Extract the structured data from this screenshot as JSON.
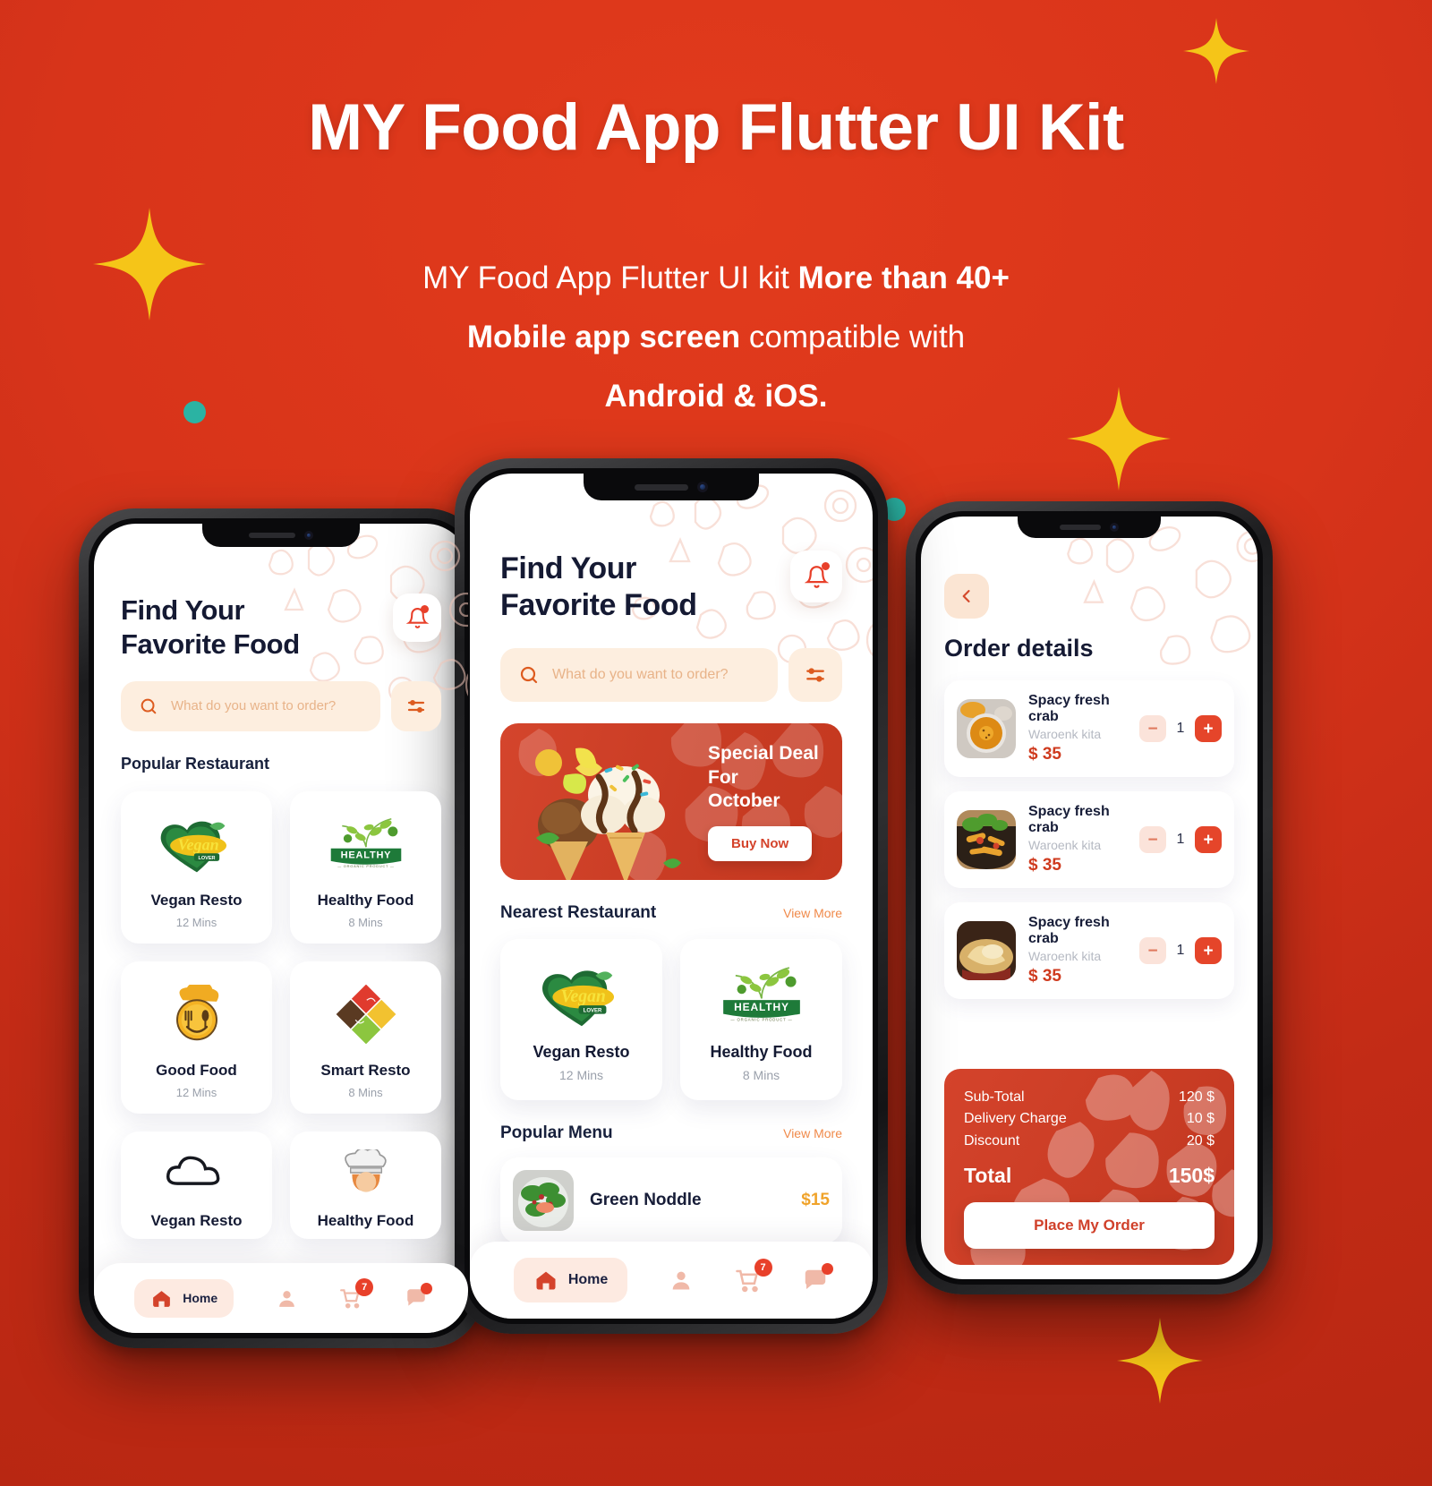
{
  "hero": {
    "title": "MY Food App Flutter UI Kit",
    "subtitle_lines": [
      {
        "normal_1": "MY Food App Flutter UI kit ",
        "bold": "More than 40+",
        "normal_2": ""
      },
      {
        "normal_1": "",
        "bold": "Mobile app screen",
        "normal_2": " compatible with"
      },
      {
        "normal_1": "",
        "bold": "Android & iOS.",
        "normal_2": ""
      }
    ],
    "background_color": "#d8341a",
    "text_color": "#ffffff",
    "sparkle_color": "#f5c518",
    "dot_color": "#2bb3a3"
  },
  "home_screen": {
    "heading_line1": "Find Your",
    "heading_line2": "Favorite Food",
    "notification_icon": "bell-icon",
    "search": {
      "placeholder": "What do you want to order?",
      "icon": "search-icon",
      "filter_icon": "filter-icon"
    },
    "promo": {
      "title_line1": "Special Deal For",
      "title_line2": "October",
      "button": "Buy Now"
    },
    "nearest": {
      "title": "Nearest Restaurant",
      "view_more": "View More",
      "cards": [
        {
          "name": "Vegan Resto",
          "time": "12 Mins",
          "logo": "vegan-lover-logo",
          "logo_top": "Vegan",
          "logo_bottom": "LOVER"
        },
        {
          "name": "Healthy Food",
          "time": "8 Mins",
          "logo": "healthy-organic-logo",
          "logo_top": "HEALTHY",
          "logo_bottom": "ORGANIC PRODUCT"
        }
      ]
    },
    "popular_menu": {
      "title": "Popular Menu",
      "view_more": "View More",
      "items": [
        {
          "name": "Green Noddle",
          "price": "$15"
        }
      ]
    },
    "nav": {
      "home_label": "Home",
      "home_icon": "home-icon",
      "profile_icon": "person-icon",
      "cart_icon": "cart-icon",
      "cart_badge": "7",
      "chat_icon": "chat-icon"
    }
  },
  "home_screen_left": {
    "heading_line1": "Find Your",
    "heading_line2": "Favorite Food",
    "search_placeholder": "What do you want to order?",
    "popular_title": "Popular Restaurant",
    "cards": [
      {
        "name": "Vegan Resto",
        "time": "12 Mins",
        "logo": "vegan-lover-logo"
      },
      {
        "name": "Healthy Food",
        "time": "8 Mins",
        "logo": "healthy-organic-logo"
      },
      {
        "name": "Good Food",
        "time": "12 Mins",
        "logo": "good-food-logo"
      },
      {
        "name": "Smart Resto",
        "time": "8 Mins",
        "logo": "smart-resto-logo"
      }
    ],
    "cut_cards": [
      {
        "name": "Vegan Resto"
      },
      {
        "name": "Healthy Food"
      }
    ],
    "nav": {
      "home_label": "Home",
      "cart_badge": "7"
    }
  },
  "order_screen": {
    "back_icon": "chevron-left-icon",
    "title": "Order details",
    "items": [
      {
        "name": "Spacy fresh crab",
        "restaurant": "Waroenk kita",
        "price": "$ 35",
        "qty": "1",
        "minus": "−",
        "plus": "+",
        "thumb": "soup-bowl-photo"
      },
      {
        "name": "Spacy fresh crab",
        "restaurant": "Waroenk kita",
        "price": "$ 35",
        "qty": "1",
        "minus": "−",
        "plus": "+",
        "thumb": "pasta-photo"
      },
      {
        "name": "Spacy fresh crab",
        "restaurant": "Waroenk kita",
        "price": "$ 35",
        "qty": "1",
        "minus": "−",
        "plus": "+",
        "thumb": "pastry-photo"
      }
    ],
    "summary": {
      "rows": [
        {
          "label": "Sub-Total",
          "value": "120 $"
        },
        {
          "label": "Delivery Charge",
          "value": "10 $"
        },
        {
          "label": "Discount",
          "value": "20 $"
        }
      ],
      "total_label": "Total",
      "total_value": "150$",
      "cta": "Place My Order"
    }
  }
}
